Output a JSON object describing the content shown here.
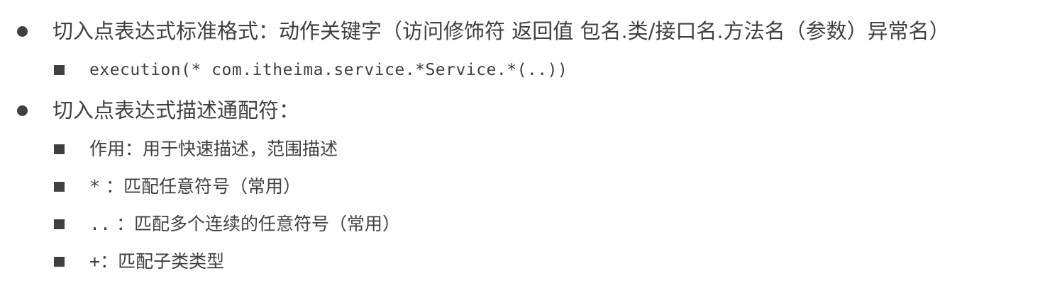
{
  "items": [
    {
      "level": 1,
      "text": "切入点表达式标准格式：动作关键字（访问修饰符  返回值  包名.类/接口名.方法名（参数）异常名）",
      "children": [
        {
          "text": "execution(* com.itheima.service.*Service.*(..))",
          "monospace": true
        }
      ]
    },
    {
      "level": 1,
      "text": "切入点表达式描述通配符：",
      "children": [
        {
          "text": "作用：用于快速描述，范围描述"
        },
        {
          "symbol": "*",
          "text": " ：匹配任意符号（常用）"
        },
        {
          "symbol": "..",
          "text": " ：匹配多个连续的任意符号（常用）"
        },
        {
          "symbol": "+",
          "text": "：匹配子类类型"
        }
      ]
    }
  ]
}
